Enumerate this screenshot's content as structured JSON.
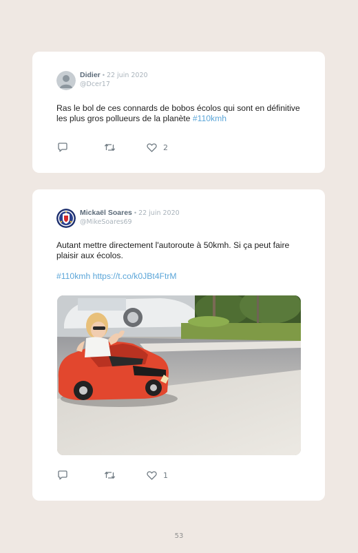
{
  "tweets": [
    {
      "name": "Didier",
      "separator": "•",
      "date": "22 juin 2020",
      "handle": "@Dcer17",
      "text_plain": "Ras le bol de ces connards de bobos écolos qui sont en définitive les plus gros pollueurs de la planète ",
      "hashtag": "#110kmh",
      "likes": "2",
      "avatar_icon": "default-user-avatar"
    },
    {
      "name": "Mickaël Soares",
      "separator": "•",
      "date": "22 juin 2020",
      "handle": "@MikeSoares69",
      "text_plain": "Autant mettre directement l'autoroute à 50kmh. Si ça peut faire plaisir aux écolos.",
      "hashtag": "#110kmh",
      "link": "https://t.co/k0JBt4FtrM",
      "likes": "1",
      "avatar_icon": "club-crest-avatar",
      "media_icon": "child-in-toy-car-photo"
    }
  ],
  "icons": {
    "reply": "reply-icon",
    "retweet": "retweet-icon",
    "like": "heart-icon"
  },
  "colors": {
    "background": "#efe8e3",
    "card": "#ffffff",
    "accent_link": "#5aa5d8",
    "name": "#5b6a78",
    "muted": "#a9b3bb"
  },
  "page": {
    "number": "53"
  }
}
